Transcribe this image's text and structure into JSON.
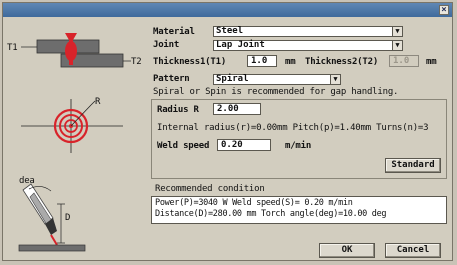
{
  "window": {
    "close_glyph": "×"
  },
  "form": {
    "material_label": "Material",
    "material_value": "Steel",
    "joint_label": "Joint",
    "joint_value": "Lap Joint",
    "thickness1_label": "Thickness1(T1)",
    "thickness1_value": "1.0",
    "thickness1_unit": "mm",
    "thickness2_label": "Thickness2(T2)",
    "thickness2_value": "1.0",
    "thickness2_unit": "mm",
    "pattern_label": "Pattern",
    "pattern_value": "Spiral",
    "hint": "Spiral or Spin is recommended for gap handling."
  },
  "diagram": {
    "t1": "T1",
    "t2": "T2",
    "r": "R",
    "dea": "dea",
    "d": "D"
  },
  "params": {
    "radius_label": "Radius R",
    "radius_value": "2.00",
    "internal_text": "Internal radius(r)=0.00mm Pitch(p)=1.40mm Turns(n)=3",
    "speed_label": "Weld speed",
    "speed_value": "0.20",
    "speed_unit": "m/min",
    "standard_button": "Standard"
  },
  "recommended": {
    "label": "Recommended condition",
    "line1": "Power(P)=3040 W  Weld speed(S)= 0.20 m/min",
    "line2": "Distance(D)=280.00 mm  Torch angle(deg)=10.00 deg"
  },
  "buttons": {
    "ok": "OK",
    "cancel": "Cancel"
  },
  "icons": {
    "close": "close-icon",
    "dropdown": "chevron-down-icon"
  },
  "colors": {
    "titlebar": "#3f6a9c",
    "weld_red": "#d8232a",
    "dialog_bg": "#d2cdbf"
  }
}
